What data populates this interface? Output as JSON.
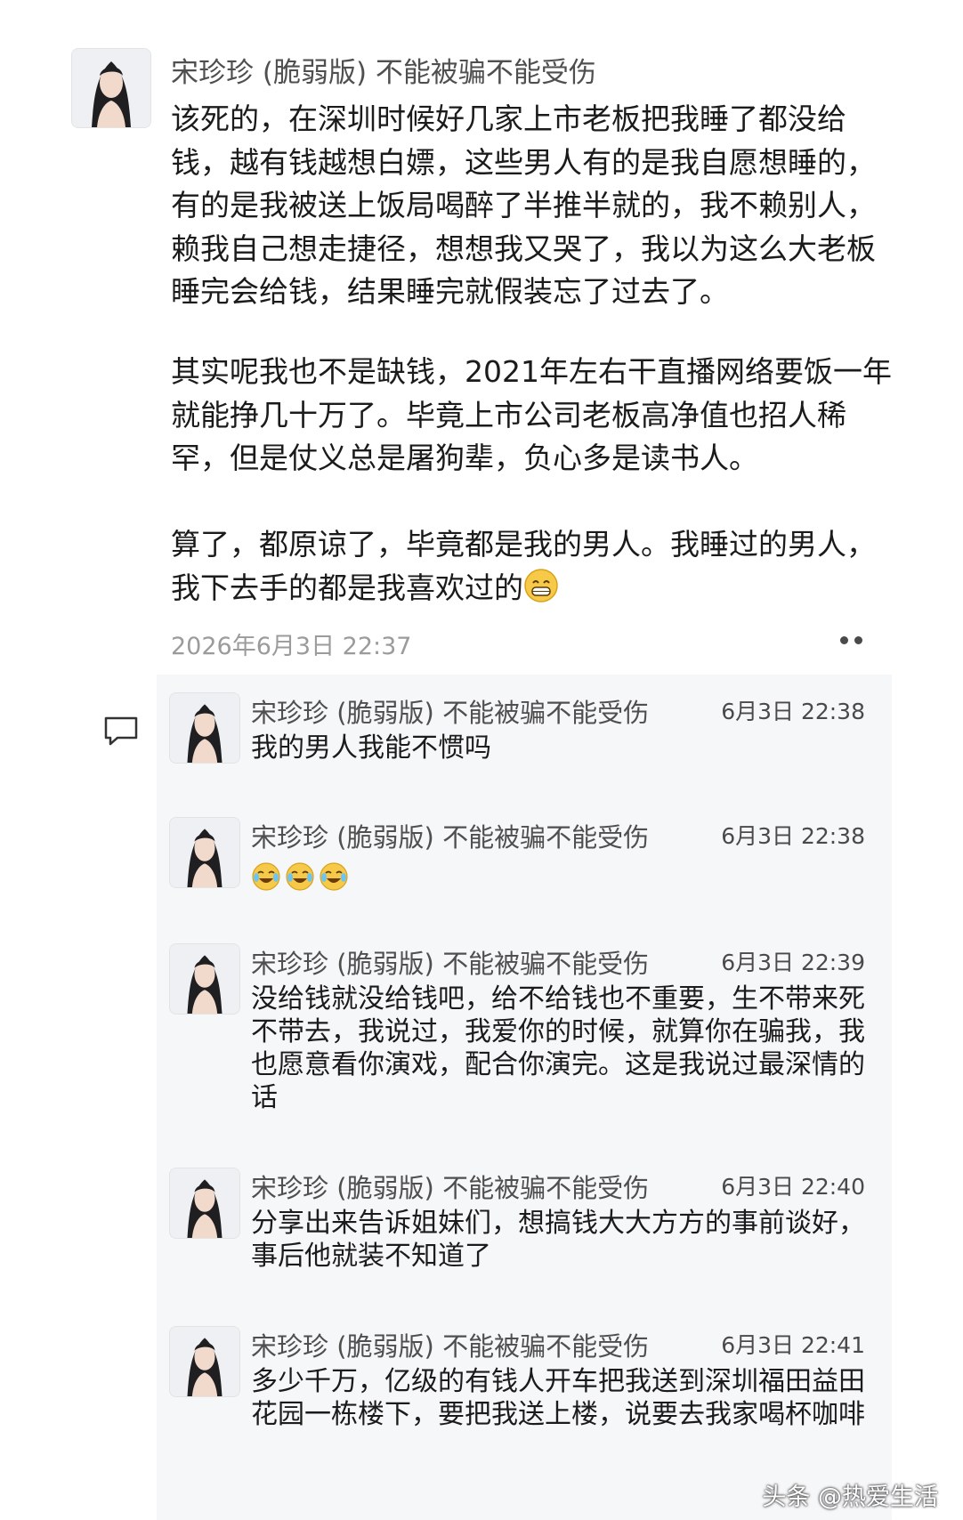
{
  "post": {
    "author": "宋珍珍 (脆弱版) 不能被骗不能受伤",
    "paragraphs": [
      "该死的，在深圳时候好几家上市老板把我睡了都没给钱，越有钱越想白嫖，这些男人有的是我自愿想睡的，有的是我被送上饭局喝醉了半推半就的，我不赖别人，赖我自己想走捷径，想想我又哭了，我以为这么大老板睡完会给钱，结果睡完就假装忘了过去了。",
      "其实呢我也不是缺钱，2021年左右干直播网络要饭一年就能挣几十万了。毕竟上市公司老板高净值也招人稀罕，但是仗义总是屠狗辈，负心多是读书人。",
      "算了，都原谅了，毕竟都是我的男人。我睡过的男人，我下去手的都是我喜欢过的"
    ],
    "trailing_emoji": "grin-emoji",
    "timestamp": "2026年6月3日 22:37"
  },
  "comments": [
    {
      "author": "宋珍珍 (脆弱版) 不能被骗不能受伤",
      "time": "6月3日 22:38",
      "text": "我的男人我能不惯吗"
    },
    {
      "author": "宋珍珍 (脆弱版) 不能被骗不能受伤",
      "time": "6月3日 22:38",
      "text": "",
      "emojis": [
        "cry-laugh-emoji",
        "cry-laugh-emoji",
        "cry-laugh-emoji"
      ]
    },
    {
      "author": "宋珍珍 (脆弱版) 不能被骗不能受伤",
      "time": "6月3日 22:39",
      "text": "没给钱就没给钱吧，给不给钱也不重要，生不带来死不带去，我说过，我爱你的时候，就算你在骗我，我也愿意看你演戏，配合你演完。这是我说过最深情的话"
    },
    {
      "author": "宋珍珍 (脆弱版) 不能被骗不能受伤",
      "time": "6月3日 22:40",
      "text": "分享出来告诉姐妹们，想搞钱大大方方的事前谈好，事后他就装不知道了"
    },
    {
      "author": "宋珍珍 (脆弱版) 不能被骗不能受伤",
      "time": "6月3日 22:41",
      "text": "多少千万，亿级的有钱人开车把我送到深圳福田益田花园一栋楼下，要把我送上楼，说要去我家喝杯咖啡"
    }
  ],
  "watermark": "头条 @热爱生活",
  "colors": {
    "panel_bg": "#f6f7f9",
    "meta_gray": "#9b9b9b",
    "name_gray": "#4f4f4f",
    "text": "#1b1b1b"
  }
}
